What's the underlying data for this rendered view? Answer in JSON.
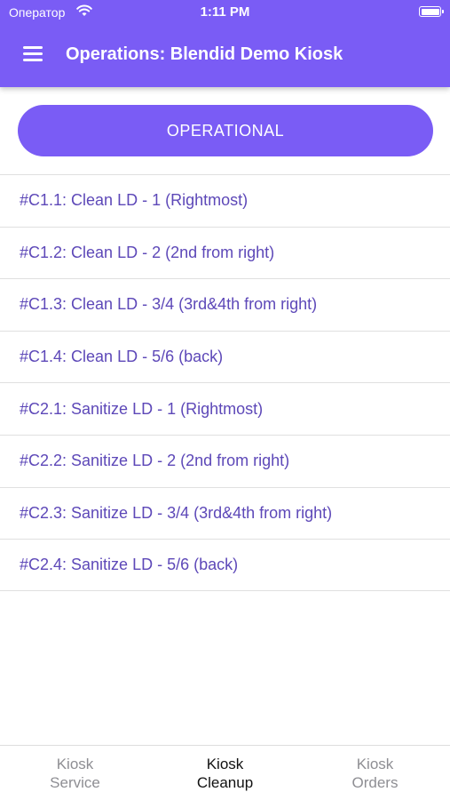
{
  "status_bar": {
    "carrier": "Оператор",
    "time": "1:11 PM"
  },
  "header": {
    "title": "Operations: Blendid Demo Kiosk"
  },
  "status_button": {
    "label": "OPERATIONAL"
  },
  "tasks": [
    {
      "label": "#C1.1: Clean LD - 1 (Rightmost)"
    },
    {
      "label": "#C1.2: Clean LD - 2 (2nd from right)"
    },
    {
      "label": "#C1.3: Clean LD - 3/4 (3rd&4th from right)"
    },
    {
      "label": "#C1.4: Clean LD - 5/6 (back)"
    },
    {
      "label": "#C2.1: Sanitize LD - 1 (Rightmost)"
    },
    {
      "label": "#C2.2: Sanitize LD - 2 (2nd from right)"
    },
    {
      "label": "#C2.3: Sanitize LD - 3/4 (3rd&4th from right)"
    },
    {
      "label": "#C2.4: Sanitize LD - 5/6 (back)"
    }
  ],
  "tabs": [
    {
      "line1": "Kiosk",
      "line2": "Service",
      "active": false
    },
    {
      "line1": "Kiosk",
      "line2": "Cleanup",
      "active": true
    },
    {
      "line1": "Kiosk",
      "line2": "Orders",
      "active": false
    }
  ],
  "colors": {
    "accent": "#7a5cf5",
    "task_text": "#5d48b8",
    "tab_inactive": "#8e8e93",
    "tab_active": "#111111"
  },
  "icons": {
    "menu": "hamburger-menu-icon",
    "wifi": "wifi-icon",
    "battery": "battery-icon"
  }
}
